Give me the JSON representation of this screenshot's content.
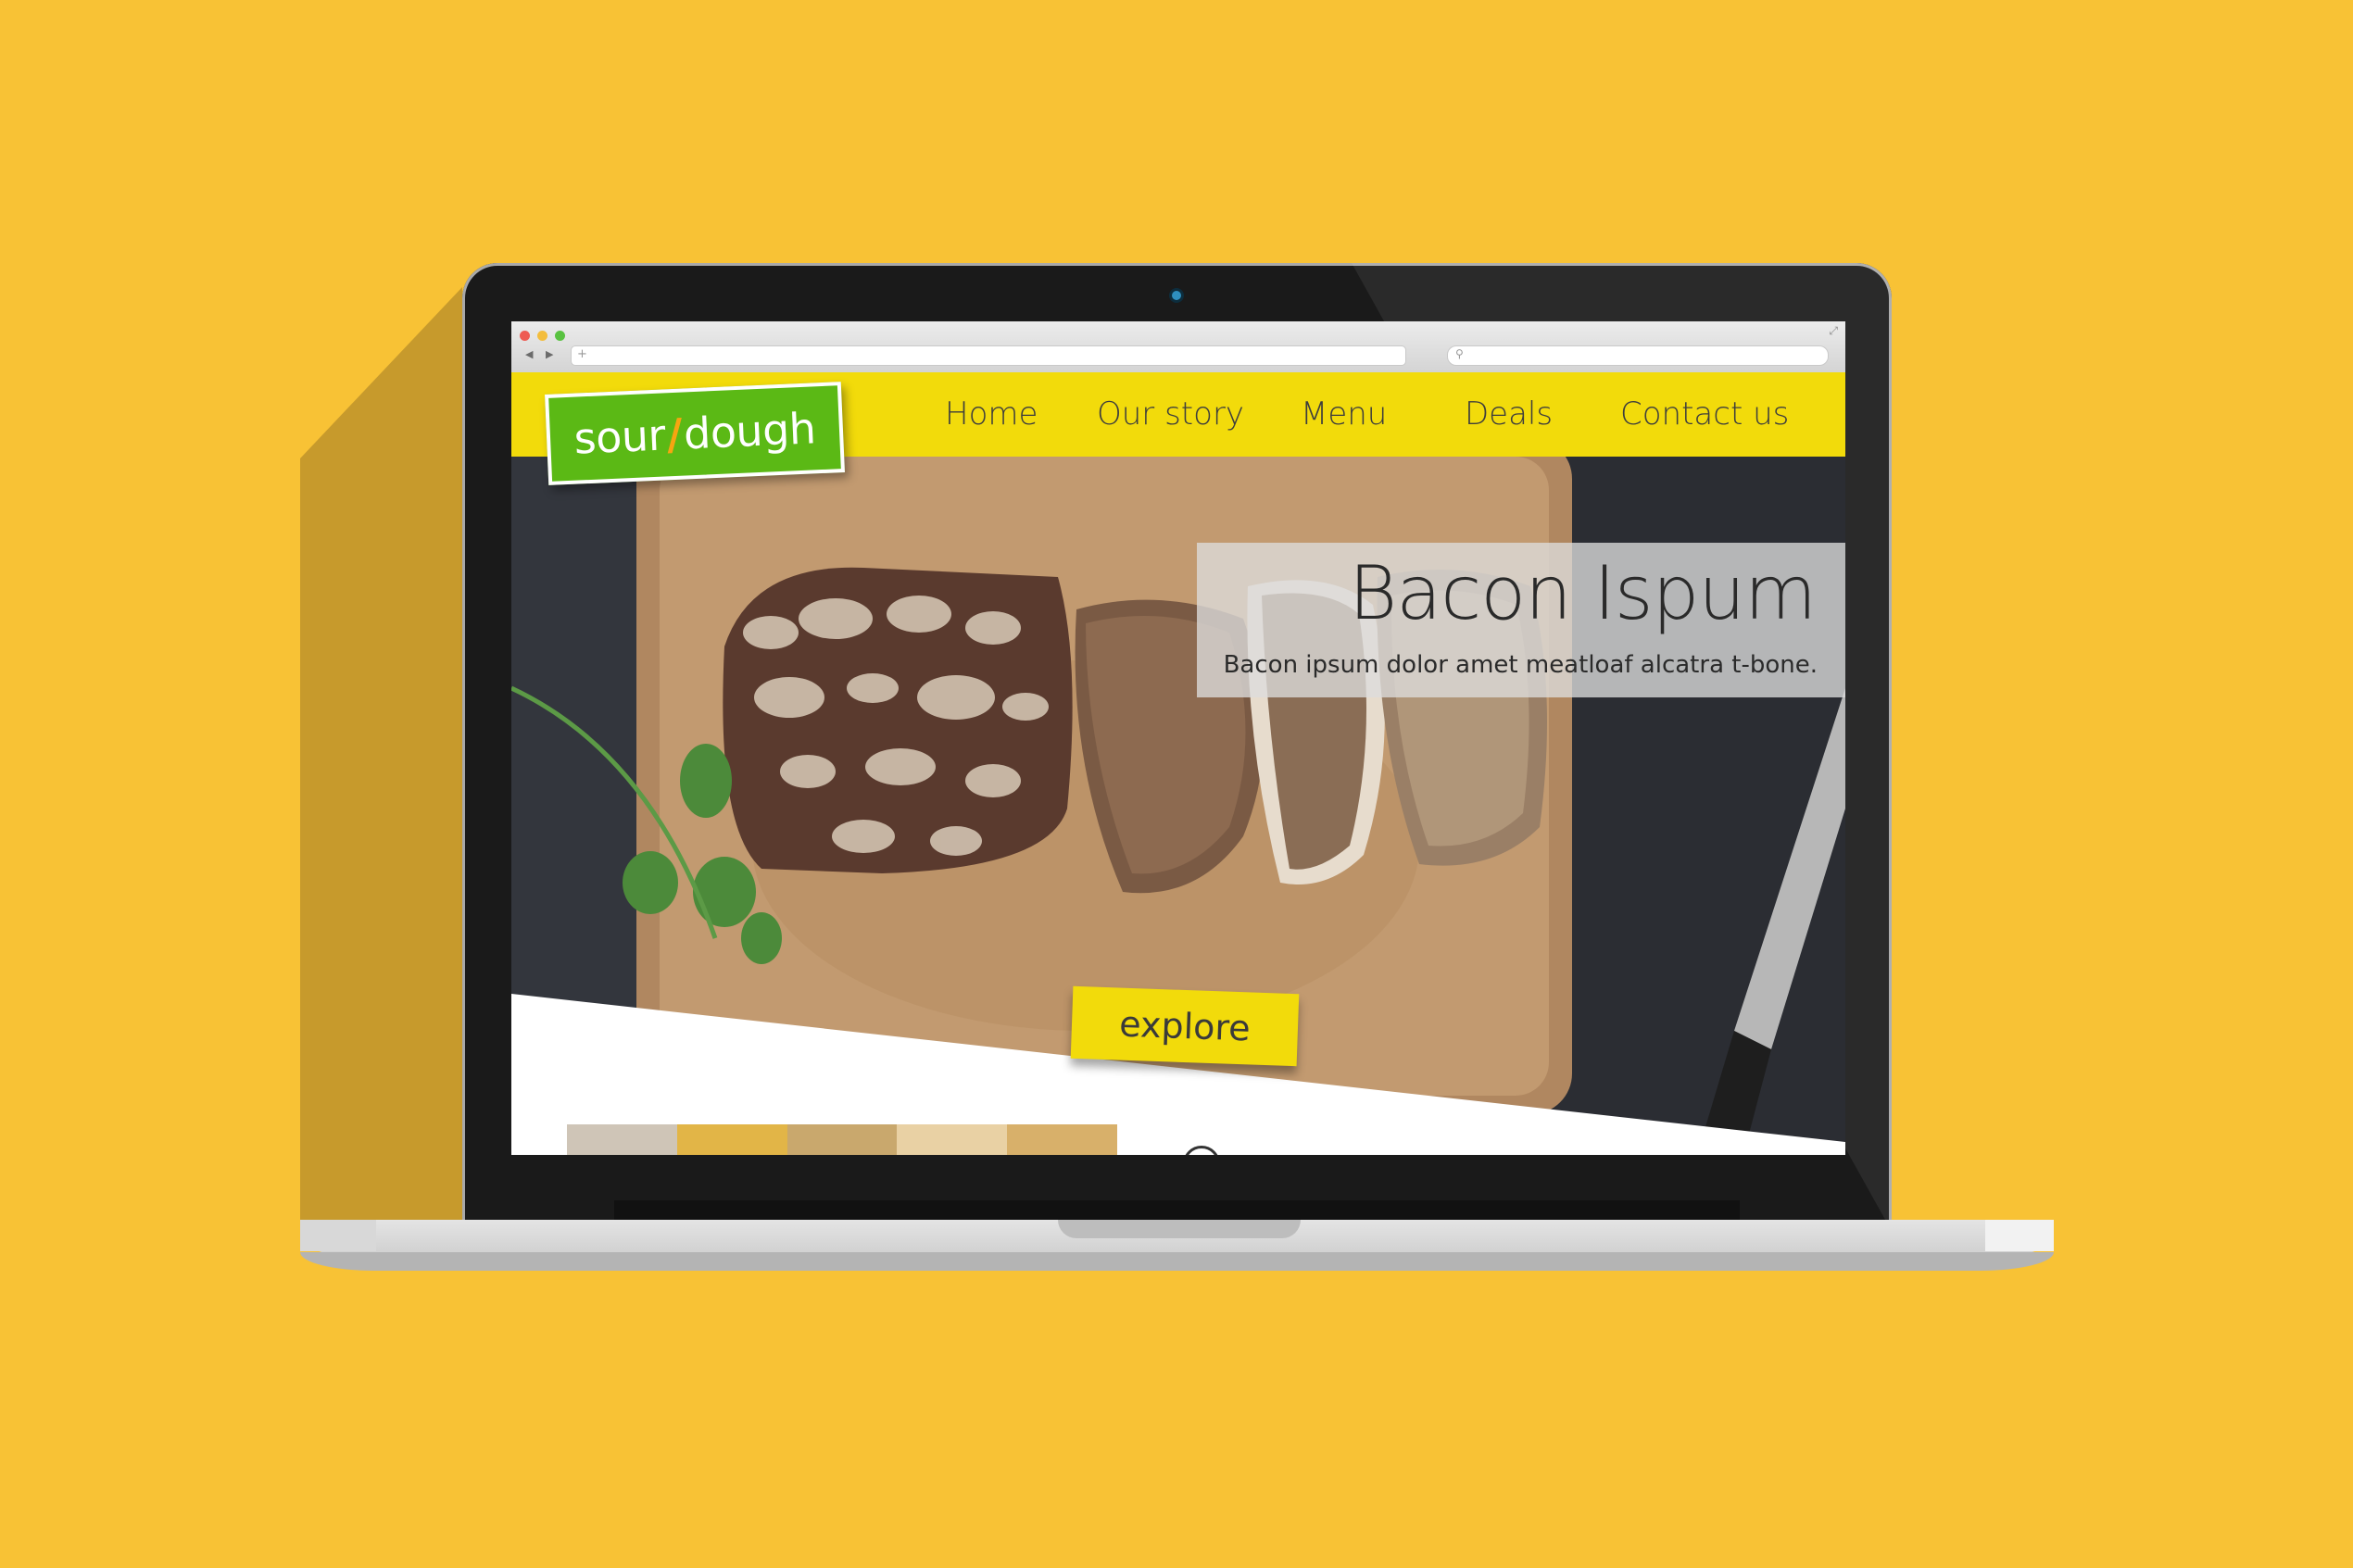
{
  "site": {
    "logo": {
      "left": "sour",
      "slash": "/",
      "right": "dough"
    },
    "nav": [
      "Home",
      "Our story",
      "Menu",
      "Deals",
      "Contact us"
    ],
    "hero": {
      "headline": "Bacon Ispum",
      "subhead": "Bacon ipsum dolor amet meatloaf alcatra t-bone.",
      "cta": "explore"
    }
  },
  "browser": {
    "address_plus": "+",
    "search_glyph": "⚲",
    "expand_glyph": "⤢",
    "back_glyph": "◀",
    "forward_glyph": "▶"
  },
  "colors": {
    "background": "#F8C235",
    "header": "#F2DB0B",
    "logo": "#5BB915",
    "logo_slash": "#F6A511"
  }
}
